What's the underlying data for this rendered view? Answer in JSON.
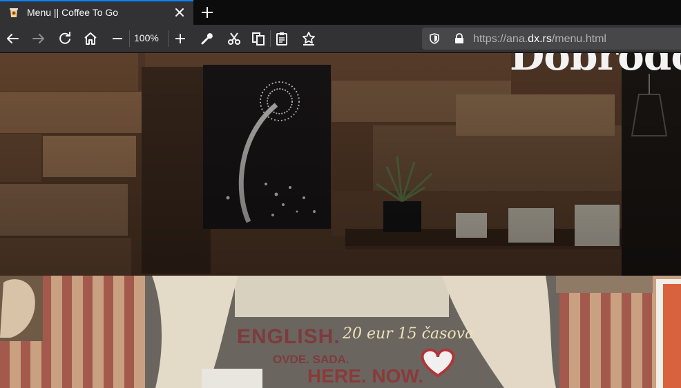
{
  "browser": {
    "tab": {
      "title": "Menu || Coffee To Go"
    },
    "zoom": "100%",
    "url": {
      "prefix": "https://ana.",
      "domain": "dx.rs",
      "path": "/menu.html"
    },
    "colors": {
      "accent": "#0a84ff",
      "toolbar": "#323234",
      "tabstrip": "#0c0c0d",
      "urlbar": "#474749"
    }
  },
  "page": {
    "welcome_text": "Dobrodo",
    "window_sign_english": "ENGLISH.",
    "window_sign_ovde": "OVDE. SADA.",
    "window_sign_herenow": "HERE. NOW.",
    "window_sign_price": "20 eur 15 časova"
  }
}
